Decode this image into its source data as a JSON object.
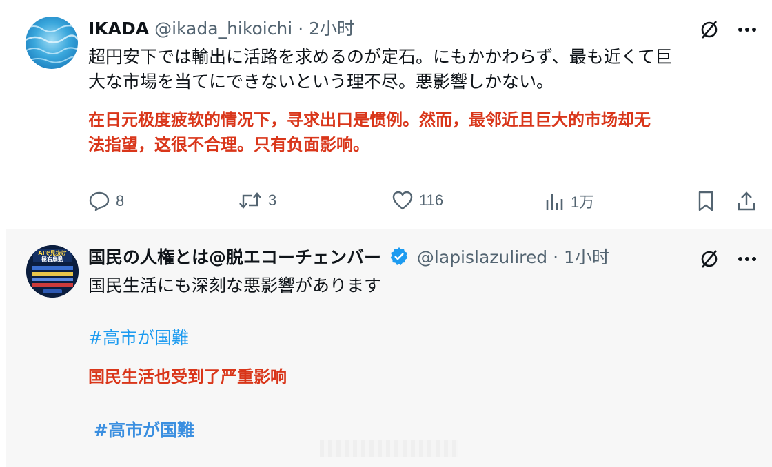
{
  "posts": [
    {
      "author_name": "IKADA",
      "handle": "@ikada_hikoichi",
      "separator": "·",
      "time": "2小时",
      "text_jp": [
        "超円安下では輸出に活路を求めるのが定石。にもかかわらず、最も近くて巨",
        "大な市場を当てにできないという理不尽。悪影響しかない。"
      ],
      "text_zh": [
        "在日元极度疲软的情况下，寻求出口是惯例。然而，最邻近且巨大的市场却无",
        "法指望，这很不合理。只有负面影响。"
      ],
      "stats": {
        "replies": "8",
        "reposts": "3",
        "likes": "116",
        "views": "1万"
      },
      "icons": [
        "reply-icon",
        "repost-icon",
        "like-icon",
        "views-icon",
        "bookmark-icon",
        "share-icon",
        "grok-icon",
        "more-icon"
      ]
    },
    {
      "author_name": "国民の人権とは@脱エコーチェンバー",
      "handle": "@lapislazulired",
      "separator": "·",
      "time": "1小时",
      "verified": true,
      "text_jp": "国民生活にも深刻な悪影響があります",
      "hashtag": "#高市が国難",
      "text_zh": "国民生活也受到了严重影响",
      "hashtag_zh": "#高市が国難",
      "avatar_text": [
        "AIで見抜け",
        "極右扇動"
      ]
    }
  ],
  "colors": {
    "accent": "#1d9bf0",
    "translation": "#d9361a",
    "meta": "#536471"
  }
}
